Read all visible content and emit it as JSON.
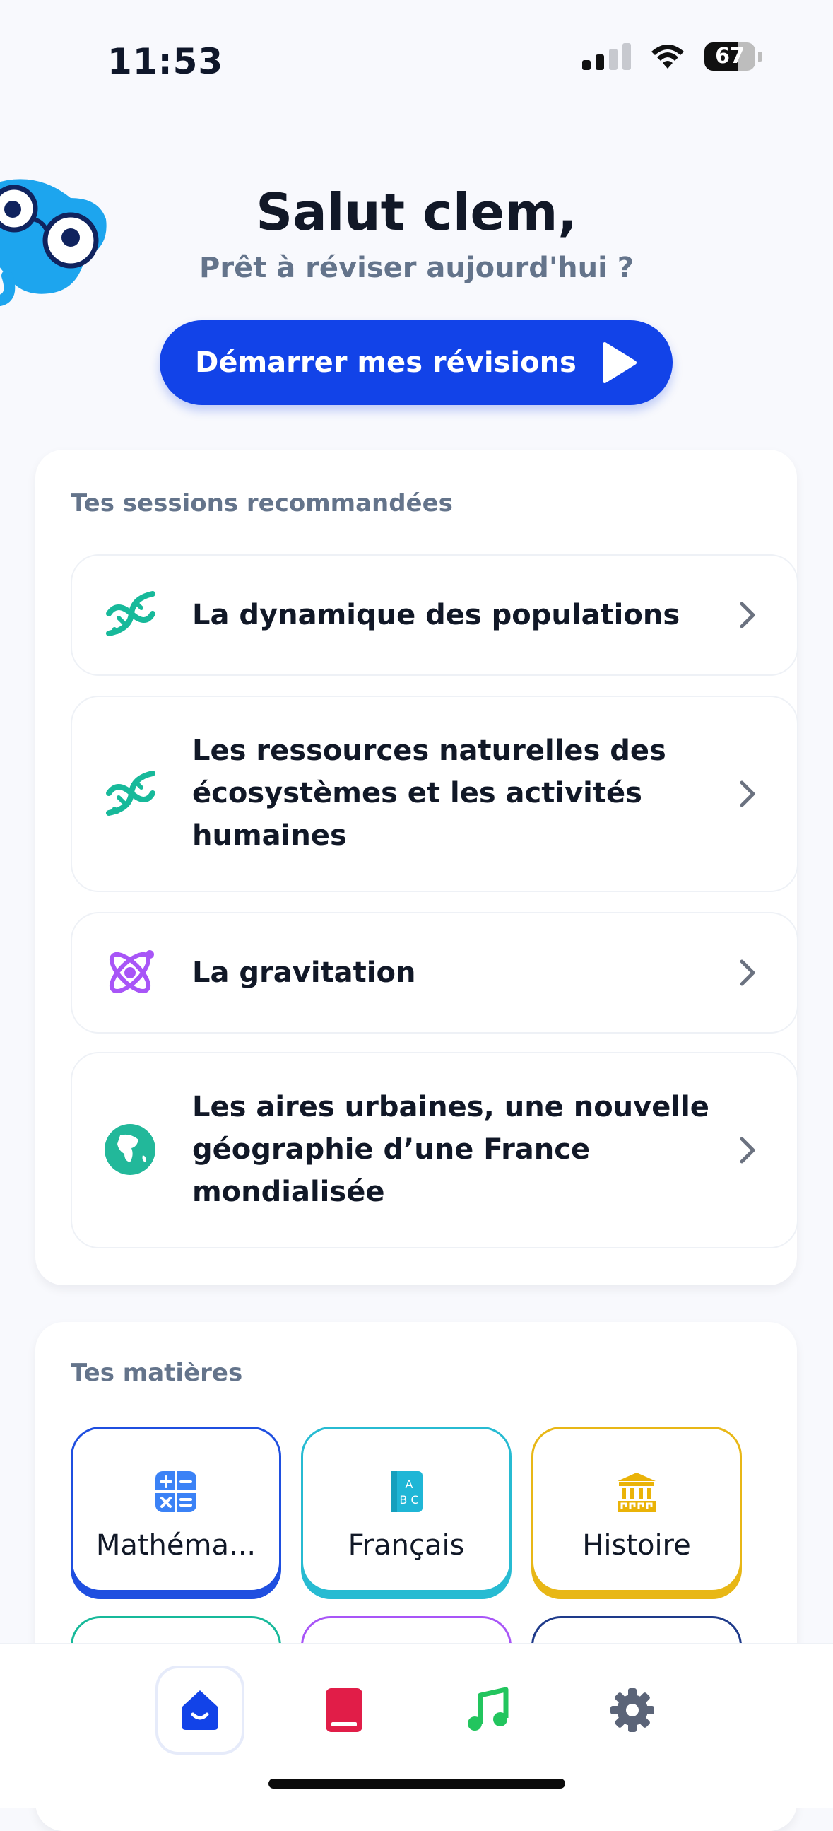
{
  "status_bar": {
    "time": "11:53",
    "battery": "67",
    "battery_fraction": 0.67,
    "signal_bars_active": 2,
    "icons": [
      "cellular-signal-icon",
      "wifi-icon",
      "battery-icon"
    ]
  },
  "header": {
    "greeting": "Salut clem,",
    "subtitle": "Prêt à réviser aujourd'hui ?",
    "start_button_label": "Démarrer mes révisions"
  },
  "sessions": {
    "title": "Tes sessions recommandées",
    "items": [
      {
        "label": "La dynamique des populations",
        "icon": "dna-icon",
        "color": "#17B99A"
      },
      {
        "label": "Les ressources naturelles des écosystèmes et les activités humaines",
        "icon": "dna-icon",
        "color": "#17B99A"
      },
      {
        "label": "La gravitation",
        "icon": "atom-icon",
        "color": "#A855F7"
      },
      {
        "label": "Les aires urbaines, une nouvelle géographie d’une France mondialisée",
        "icon": "globe-icon",
        "color": "#22B89A"
      }
    ]
  },
  "subjects": {
    "title": "Tes matières",
    "items": [
      {
        "label": "Mathéma...",
        "icon": "calculator-icon",
        "color": "#1F4FE0"
      },
      {
        "label": "Français",
        "icon": "abc-book-icon",
        "color": "#27BBD2"
      },
      {
        "label": "Histoire",
        "icon": "temple-icon",
        "color": "#E8B716"
      }
    ],
    "partial_row_colors": [
      "#17B99A",
      "#A855F7",
      "#1E3A8A"
    ]
  },
  "bottom_nav": {
    "items": [
      {
        "name": "home",
        "icon": "home-icon",
        "color": "#1243E8",
        "active": true
      },
      {
        "name": "book",
        "icon": "book-icon",
        "color": "#E11D48",
        "active": false
      },
      {
        "name": "music",
        "icon": "music-note-icon",
        "color": "#22C55E",
        "active": false
      },
      {
        "name": "settings",
        "icon": "gear-icon",
        "color": "#5B6478",
        "active": false
      }
    ]
  }
}
